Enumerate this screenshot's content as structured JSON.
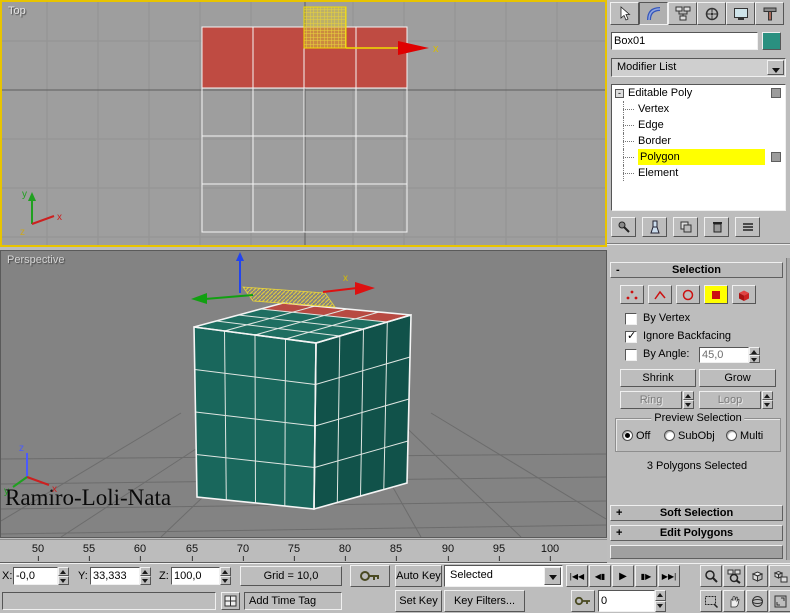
{
  "viewports": {
    "top": {
      "label": "Top"
    },
    "perspective": {
      "label": "Perspective",
      "watermark": "Ramiro-Loli-Nata"
    }
  },
  "glyphs": {
    "collapse": "-",
    "expand": "+",
    "x": "x",
    "y": "y",
    "z": "z"
  },
  "command_panel": {
    "object_name": "Box01",
    "modifier_list": "Modifier List",
    "stack": {
      "root": "Editable Poly",
      "items": [
        "Vertex",
        "Edge",
        "Border",
        "Polygon",
        "Element"
      ],
      "selected": "Polygon"
    },
    "selection": {
      "title": "Selection",
      "by_vertex": "By Vertex",
      "ignore_backfacing": "Ignore Backfacing",
      "by_angle": "By Angle:",
      "by_angle_value": "45,0",
      "shrink": "Shrink",
      "grow": "Grow",
      "ring": "Ring",
      "loop": "Loop",
      "preview_title": "Preview Selection",
      "preview_off": "Off",
      "preview_subobj": "SubObj",
      "preview_multi": "Multi",
      "status": "3 Polygons Selected"
    },
    "rollouts": {
      "soft_selection": "Soft Selection",
      "edit_polygons": "Edit Polygons"
    }
  },
  "timeline": {
    "ticks": [
      "50",
      "55",
      "60",
      "65",
      "70",
      "75",
      "80",
      "85",
      "90",
      "95",
      "100"
    ]
  },
  "status": {
    "x_label": "X:",
    "x_value": "-0,0",
    "y_label": "Y:",
    "y_value": "33,333",
    "z_label": "Z:",
    "z_value": "100,0",
    "grid_label": "Grid = 10,0",
    "auto_key": "Auto Key",
    "set_key": "Set Key",
    "selected_filter": "Selected",
    "key_filters": "Key Filters...",
    "add_time_tag": "Add Time Tag",
    "frame_value": "0",
    "playback": [
      "|◀◀",
      "◀▮",
      "▶",
      "▮▶",
      "▶▶|"
    ]
  },
  "colors": {
    "active_viewport_border": "#e8c400",
    "selection_red": "#bf4b42",
    "object_teal": "#19675c",
    "object_color_swatch": "#2a9080",
    "highlight_yellow": "#ffff00"
  }
}
